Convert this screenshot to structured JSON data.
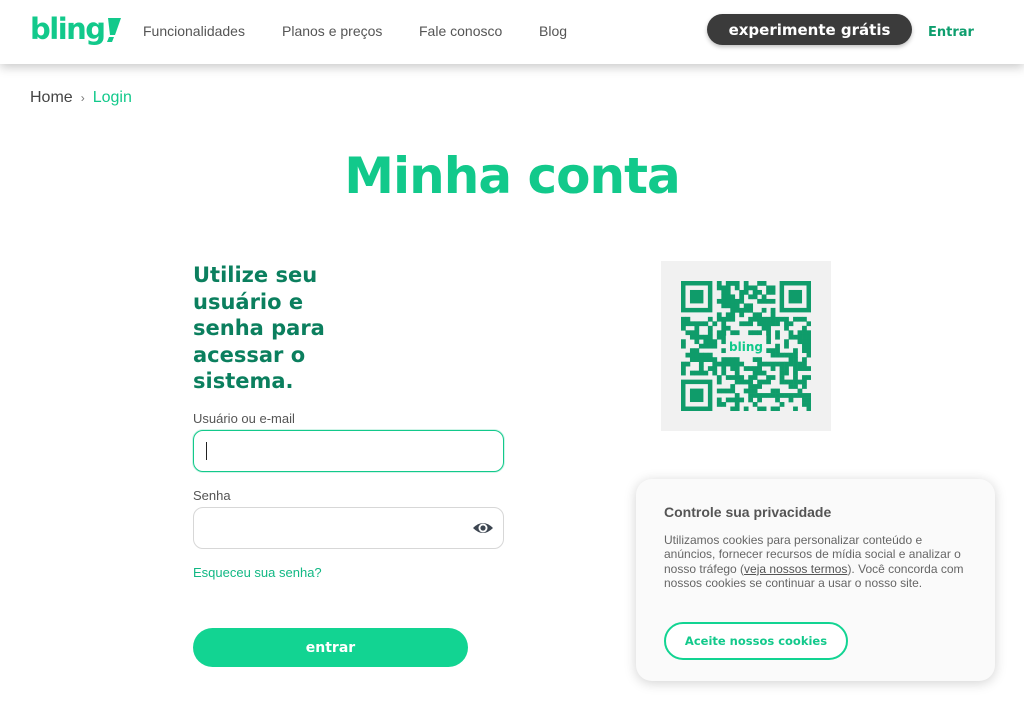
{
  "header": {
    "logo_text": "bling",
    "nav": [
      {
        "label": "Funcionalidades"
      },
      {
        "label": "Planos e preços"
      },
      {
        "label": "Fale conosco"
      },
      {
        "label": "Blog"
      }
    ],
    "trial_button": "experimente grátis",
    "login_link": "Entrar"
  },
  "breadcrumb": {
    "home": "Home",
    "separator": "›",
    "current": "Login"
  },
  "page": {
    "title": "Minha conta"
  },
  "login_form": {
    "heading": "Utilize seu usuário e senha para acessar o sistema.",
    "username_label": "Usuário ou e-mail",
    "username_value": "",
    "password_label": "Senha",
    "password_value": "",
    "forgot_link": "Esqueceu sua senha?",
    "submit_label": "entrar"
  },
  "qr": {
    "center_logo_text": "bling"
  },
  "cookie_banner": {
    "title": "Controle sua privacidade",
    "text_before_link": "Utilizamos cookies para personalizar conteúdo e anúncios, fornecer recursos de mídia social e analizar o nosso tráfego (",
    "link_text": "veja nossos termos",
    "text_after_link": "). Você concorda com nossos cookies se continuar a usar o nosso site.",
    "accept_button": "Aceite nossos cookies"
  },
  "colors": {
    "brand_green": "#12c98b",
    "dark_green": "#0b7f5e",
    "dark_button": "#3b3b3b"
  },
  "icons": {
    "password_toggle": "eye-icon"
  }
}
